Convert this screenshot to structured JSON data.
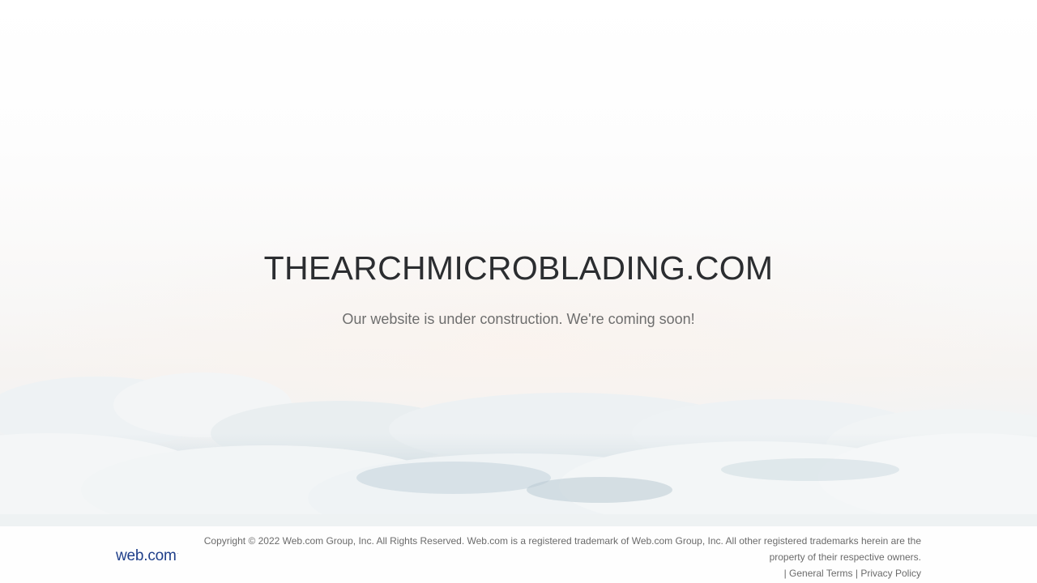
{
  "hero": {
    "headline": "THEARCHMICROBLADING.COM",
    "subline": "Our website is under construction. We're coming soon!"
  },
  "footer": {
    "logo_text": "web.com",
    "logo_mark": "·",
    "copyright_line1": "Copyright © 2022 Web.com Group, Inc. All Rights Reserved. Web.com is a registered trademark of Web.com Group, Inc. All other registered trademarks herein are the",
    "copyright_line2": "property of their respective owners.",
    "separator": "|",
    "links": [
      {
        "label": "General Terms"
      },
      {
        "label": "Privacy Policy"
      }
    ]
  },
  "colors": {
    "headline": "#2b2d30",
    "subline": "#6e6e6e",
    "logo": "#1f3f8a",
    "footer_text": "#6b6b6b"
  }
}
